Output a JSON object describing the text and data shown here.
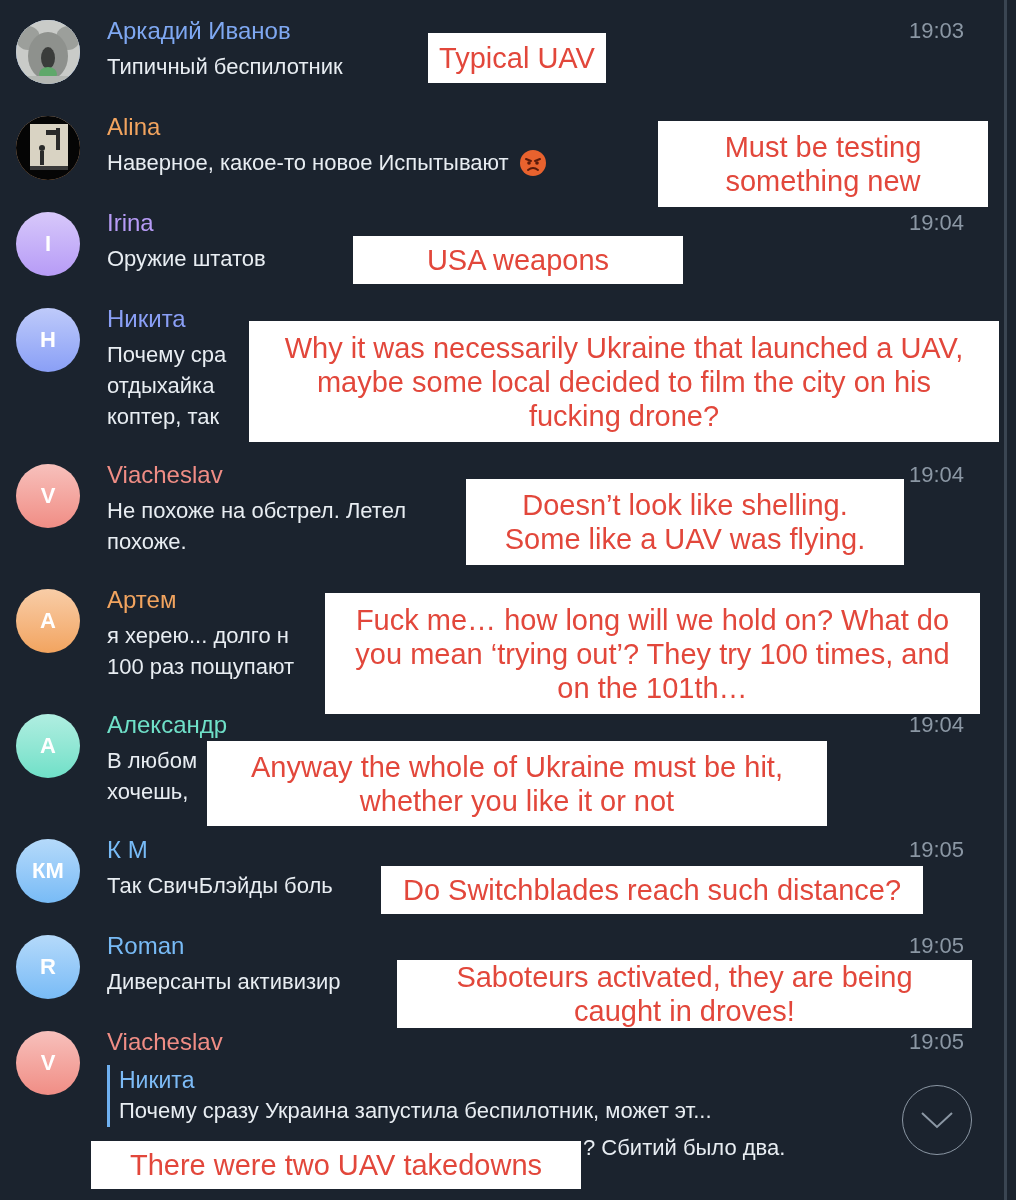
{
  "messages": [
    {
      "sender": "Аркадий Иванов",
      "color": "#7fa8f2",
      "avatar": {
        "kind": "picture"
      },
      "time": "19:03",
      "lines": [
        "Типичный беспилотник"
      ],
      "note": "Typical UAV"
    },
    {
      "sender": "Alina",
      "color": "#f2a45f",
      "avatar": {
        "kind": "picture"
      },
      "lines": [
        "Наверное, какое-то новое Испытывают"
      ],
      "end_icon": {
        "kind": "emoji"
      },
      "note": "Must be testing something new"
    },
    {
      "sender": "Irina",
      "color": "#b79bf6",
      "avatar": {
        "kind": "letter",
        "letter": "I"
      },
      "time": "19:04",
      "lines": [
        "Оружие штатов"
      ],
      "note": "USA weapons"
    },
    {
      "sender": "Никита",
      "color": "#8a9ff6",
      "avatar": {
        "kind": "letter",
        "letter": "Н"
      },
      "lines": [
        "Почему сра",
        "отдыхайка",
        "коптер, так"
      ],
      "note": "Why it was necessarily Ukraine that launched a UAV, maybe some local decided to film the city on his fucking drone?"
    },
    {
      "sender": "Viacheslav",
      "color": "#f08d85",
      "avatar": {
        "kind": "letter",
        "letter": "V"
      },
      "time": "19:04",
      "lines": [
        "Не похоже на обстрел. Летел",
        "похоже."
      ],
      "note": "Doesn’t look like shelling. Some like a UAV was flying."
    },
    {
      "sender": "Артем",
      "color": "#f2a45f",
      "avatar": {
        "kind": "letter",
        "letter": "А"
      },
      "lines": [
        "я херею... долго н",
        "100 раз пощупают"
      ],
      "note": "Fuck me… how long will we hold on? What do you mean ‘trying out’? They try 100 times, and on the 101th…"
    },
    {
      "sender": "Александр",
      "color": "#6fe0c8",
      "avatar": {
        "kind": "letter",
        "letter": "А"
      },
      "time": "19:04",
      "lines": [
        "В любом",
        "хочешь,"
      ],
      "note": "Anyway the whole of Ukraine must be hit, whether you like it or not"
    },
    {
      "sender": "К М",
      "color": "#78bbf6",
      "avatar": {
        "kind": "letter",
        "letter": "КМ"
      },
      "time": "19:05",
      "lines": [
        "Так СвичБлэйды боль"
      ],
      "note": "Do Switchblades reach such distance?"
    },
    {
      "sender": "Roman",
      "color": "#78bbf6",
      "avatar": {
        "kind": "letter",
        "letter": "R"
      },
      "time": "19:05",
      "lines": [
        "Диверсанты активизир"
      ],
      "note": "Saboteurs activated, they are being caught in droves!"
    },
    {
      "sender": "Viacheslav",
      "color": "#f08d85",
      "avatar": {
        "kind": "letter",
        "letter": "V"
      },
      "time": "19:05",
      "reply": {
        "sender": "Никита",
        "text": "Почему сразу Украина запустила беспилотник, может эт..."
      },
      "lines": [
        "? Сбитий было два."
      ],
      "note": "There were two UAV takedowns"
    }
  ]
}
